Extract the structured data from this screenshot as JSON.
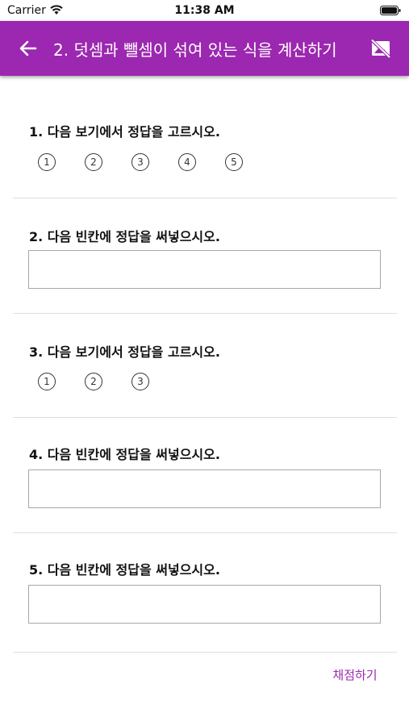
{
  "status_bar": {
    "carrier": "Carrier",
    "time": "11:38 AM"
  },
  "app_bar": {
    "title": "2. 덧셈과 뺄셈이 섞여 있는 식을 계산하기",
    "back_icon": "arrow-left-icon",
    "action_icon": "image-off-icon",
    "color": "#9c27b0"
  },
  "questions": [
    {
      "text": "1. 다음 보기에서 정답을 고르시오.",
      "type": "choice",
      "options": [
        "1",
        "2",
        "3",
        "4",
        "5"
      ]
    },
    {
      "text": "2. 다음 빈칸에 정답을 써넣으시오.",
      "type": "input",
      "value": ""
    },
    {
      "text": "3. 다음 보기에서 정답을 고르시오.",
      "type": "choice",
      "options": [
        "1",
        "2",
        "3"
      ]
    },
    {
      "text": "4. 다음 빈칸에 정답을 써넣으시오.",
      "type": "input",
      "value": ""
    },
    {
      "text": "5. 다음 빈칸에 정답을 써넣으시오.",
      "type": "input",
      "value": ""
    }
  ],
  "grade_button": {
    "label": "채점하기"
  }
}
